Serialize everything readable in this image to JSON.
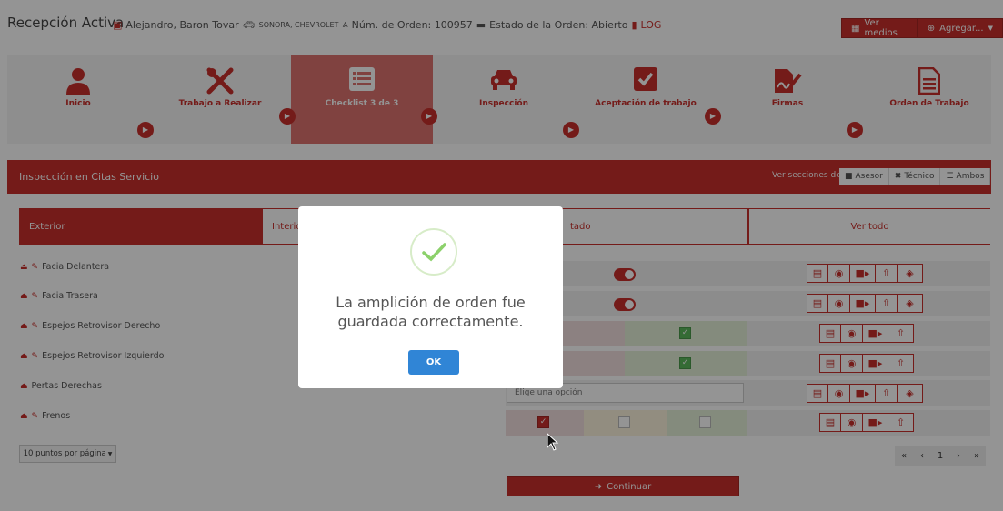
{
  "header": {
    "title": "Recepción Activa",
    "customer": "Alejandro, Baron Tovar",
    "vehicle": "SONORA, CHEVROLET",
    "order_label": "Núm. de Orden: 100957",
    "status_label": "Estado de la Orden: Abierto",
    "log_label": "LOG",
    "buttons": {
      "media": "Ver medios",
      "add": "Agregar..."
    }
  },
  "steps": [
    {
      "label": "Inicio",
      "icon": "user-icon"
    },
    {
      "label": "Trabajo a Realizar",
      "icon": "tools-icon"
    },
    {
      "label": "Checklist 3 de 3",
      "icon": "list-icon",
      "active": true
    },
    {
      "label": "Inspección",
      "icon": "car-icon"
    },
    {
      "label": "Aceptación de trabajo",
      "icon": "check-square-icon"
    },
    {
      "label": "Firmas",
      "icon": "signature-icon"
    },
    {
      "label": "Orden de Trabajo",
      "icon": "document-icon"
    }
  ],
  "panel": {
    "title": "Inspección en Citas Servicio",
    "view_label": "Ver secciones de:",
    "view_buttons": {
      "advisor": "Asesor",
      "technician": "Técnico",
      "both": "Ambos"
    }
  },
  "tabs": {
    "exterior": "Exterior",
    "interior": "Interior",
    "state": "tado",
    "all": "Ver todo"
  },
  "rows": [
    {
      "label": "Facia Delantera"
    },
    {
      "label": "Facia Trasera"
    },
    {
      "label": "Espejos Retrovisor Derecho"
    },
    {
      "label": "Espejos Retrovisor Izquierdo"
    },
    {
      "label": "Pertas Derechas"
    },
    {
      "label": "Frenos"
    }
  ],
  "select_placeholder": "Elige una opción",
  "per_page": "10 puntos por página",
  "pagination": {
    "first": "«",
    "prev": "‹",
    "current": "1",
    "next": "›",
    "last": "»"
  },
  "continue_label": "Continuar",
  "modal": {
    "message": "La amplición de orden fue guardada correctamente.",
    "ok": "OK"
  },
  "colors": {
    "accent": "#c9302c",
    "active_step": "#dc726e",
    "ok_button": "#3085d6",
    "success": "#8cd16b"
  }
}
